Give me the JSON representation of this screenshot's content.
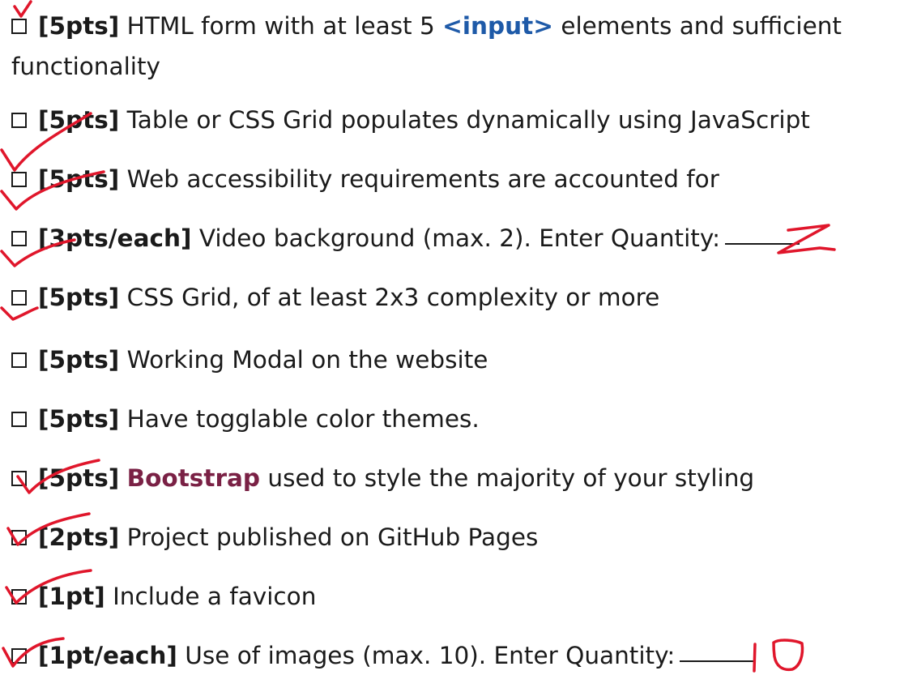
{
  "ink_color": "#e0162b",
  "accent_blue": "#1e5aa8",
  "accent_purple": "#7a2145",
  "items": [
    {
      "points": "[5pts]",
      "before": " HTML form with at least 5 ",
      "highlight": "<input>",
      "after": " elements and sufficient",
      "continuation": "functionality",
      "checked": true
    },
    {
      "points": "[5pts]",
      "text": " Table or CSS Grid populates dynamically using JavaScript",
      "checked": false
    },
    {
      "points": "[5pts]",
      "text": " Web accessibility requirements are accounted for",
      "checked": true
    },
    {
      "points": "[3pts/each]",
      "text": " Video background (max. 2). Enter Quantity:",
      "quantity": "2",
      "checked": true
    },
    {
      "points": "[5pts]",
      "text": " CSS Grid, of at least 2x3 complexity or more",
      "checked": true
    },
    {
      "points": "[5pts]",
      "text": " Working Modal on the website",
      "checked": false
    },
    {
      "points": "[5pts]",
      "text": " Have togglable color themes.",
      "checked": false
    },
    {
      "points": "[5pts]",
      "before": " ",
      "highlight": "Bootstrap",
      "after": " used to style the majority of your styling",
      "checked": true
    },
    {
      "points": "[2pts]",
      "text": " Project published on GitHub Pages",
      "checked": true
    },
    {
      "points": "[1pt]",
      "text": " Include a favicon",
      "checked": true
    },
    {
      "points": "[1pt/each]",
      "text": " Use of images (max. 10). Enter Quantity:",
      "quantity": "10",
      "checked": true
    }
  ]
}
